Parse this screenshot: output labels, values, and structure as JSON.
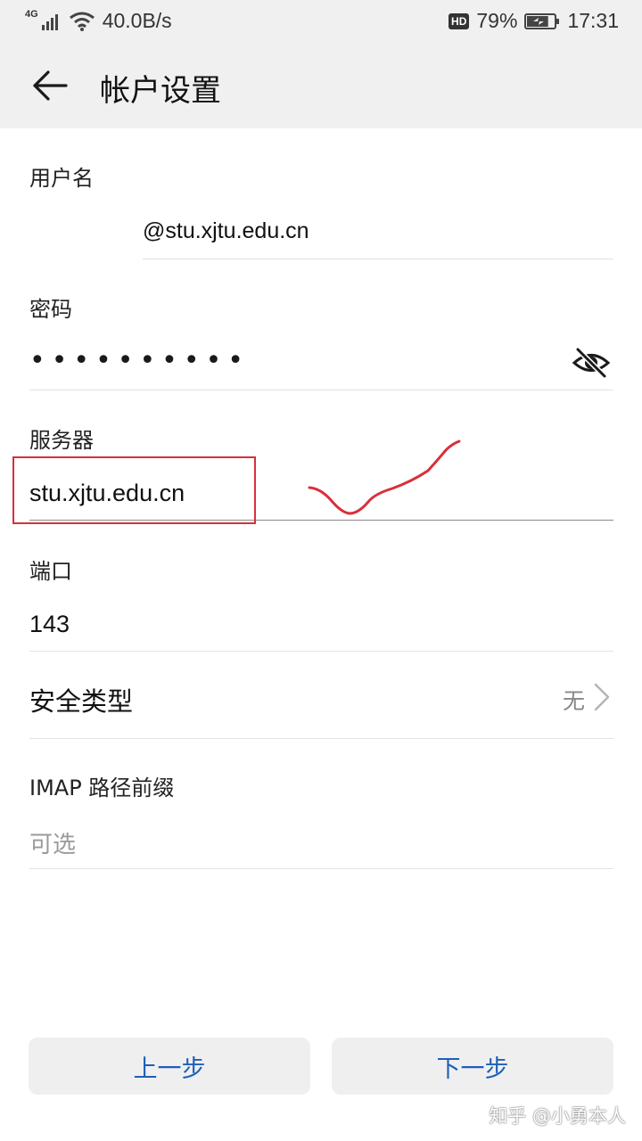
{
  "status_bar": {
    "network_type": "4G",
    "net_speed": "40.0B/s",
    "hd_badge": "HD",
    "battery_percent": "79%",
    "battery_level": 0.79,
    "time": "17:31"
  },
  "header": {
    "title": "帐户设置",
    "back_icon": "arrow-left-icon"
  },
  "form": {
    "username": {
      "label": "用户名",
      "value": "@stu.xjtu.edu.cn"
    },
    "password": {
      "label": "密码",
      "masked_value": "••••••••••",
      "toggle_icon": "eye-slash-icon"
    },
    "server": {
      "label": "服务器",
      "value": "stu.xjtu.edu.cn"
    },
    "port": {
      "label": "端口",
      "value": "143"
    },
    "security": {
      "label": "安全类型",
      "value": "无",
      "icon": "chevron-right-icon"
    },
    "imap_prefix": {
      "label": "IMAP 路径前缀",
      "placeholder": "可选"
    }
  },
  "buttons": {
    "previous": "上一步",
    "next": "下一步"
  },
  "watermark": "知乎 @小勇本人",
  "colors": {
    "header_bg": "#f0f0f0",
    "accent": "#1f5fb7",
    "annotation": "#d8303a"
  }
}
